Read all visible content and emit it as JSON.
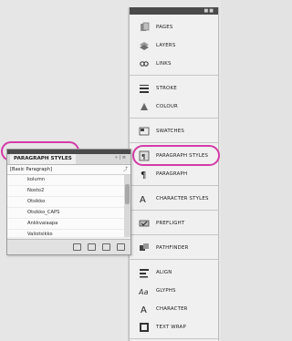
{
  "dock": {
    "groups": [
      [
        {
          "label": "PAGES",
          "icon": "pages-icon"
        },
        {
          "label": "LAYERS",
          "icon": "layers-icon"
        },
        {
          "label": "LINKS",
          "icon": "links-icon"
        }
      ],
      [
        {
          "label": "STROKE",
          "icon": "stroke-icon"
        },
        {
          "label": "COLOUR",
          "icon": "colour-icon"
        }
      ],
      [
        {
          "label": "SWATCHES",
          "icon": "swatches-icon"
        }
      ],
      [
        {
          "label": "PARAGRAPH STYLES",
          "icon": "paragraph-styles-icon",
          "highlight": true
        },
        {
          "label": "PARAGRAPH",
          "icon": "paragraph-icon"
        }
      ],
      [
        {
          "label": "CHARACTER STYLES",
          "icon": "character-styles-icon"
        }
      ],
      [
        {
          "label": "PREFLIGHT",
          "icon": "preflight-icon"
        }
      ],
      [
        {
          "label": "PATHFINDER",
          "icon": "pathfinder-icon"
        }
      ],
      [
        {
          "label": "ALIGN",
          "icon": "align-icon"
        },
        {
          "label": "GLYPHS",
          "icon": "glyphs-icon"
        },
        {
          "label": "CHARACTER",
          "icon": "character-icon"
        },
        {
          "label": "TEXT WRAP",
          "icon": "text-wrap-icon"
        }
      ]
    ]
  },
  "floating_panel": {
    "tab_label": "PARAGRAPH STYLES",
    "tab_controls": "» | ≡",
    "basic_label": "[Basic Paragraph]",
    "styles": [
      "kolumn",
      "Nosto2",
      "Otsikko",
      "Otsikko_CAPS",
      "Ankkvaiaapa",
      "Valiotsikko"
    ]
  }
}
